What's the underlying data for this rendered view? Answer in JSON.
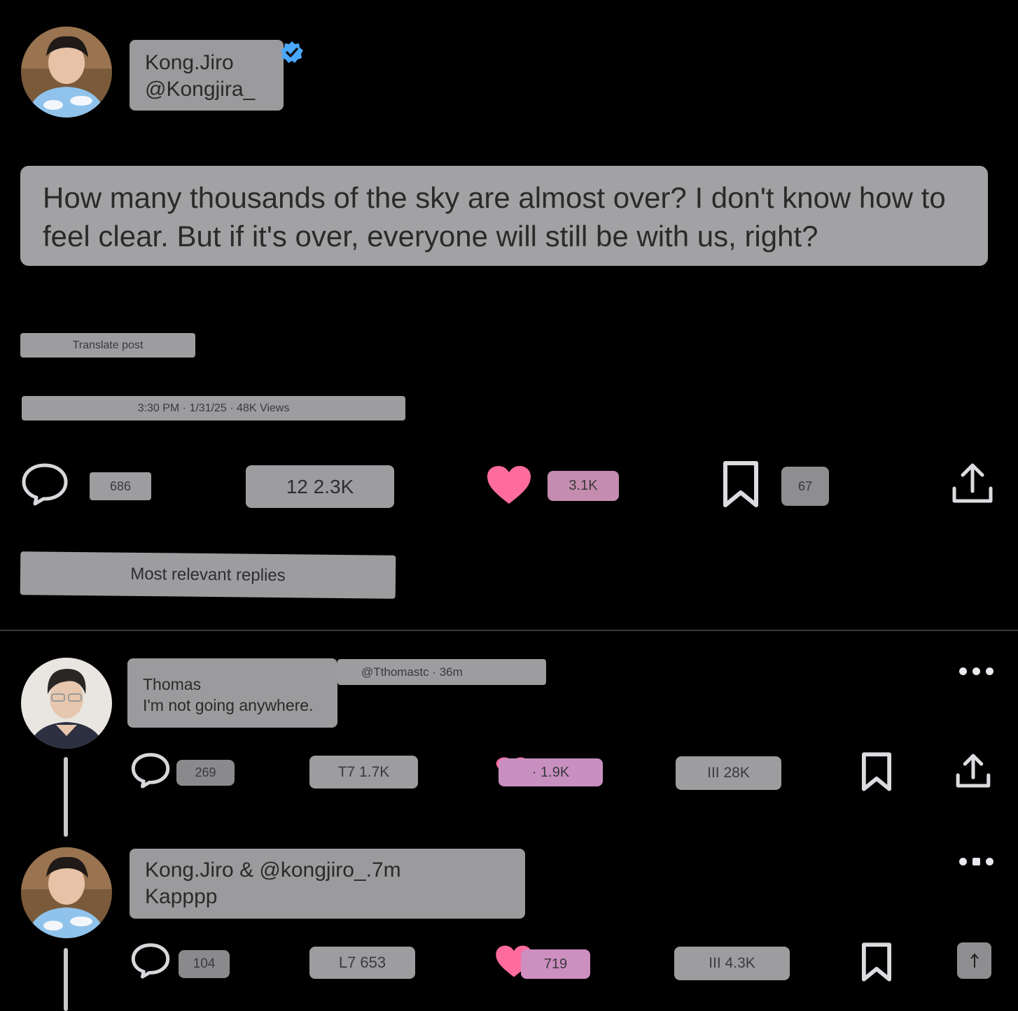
{
  "post": {
    "author_name": "Kong.Jiro",
    "author_handle": "@Kongjira_",
    "text": "How many thousands of the sky are almost over? I don't know how to feel clear. But if it's over, everyone will still be with us, right?",
    "translate_label": "Translate post",
    "meta": "3:30 PM · 1/31/25 · 48K Views",
    "stats": {
      "replies": "686",
      "reposts": "12 2.3K",
      "likes": "3.1K",
      "bookmarks": "67"
    }
  },
  "replies_header": "Most relevant replies",
  "replies": [
    {
      "name": "Thomas",
      "handle_time": "@Tthomastc · 36m",
      "text": "I'm not going anywhere.",
      "replies": "269",
      "reposts": "T7 1.7K",
      "likes": "· 1.9K",
      "views": "III 28K"
    },
    {
      "name_line": "Kong.Jiro & @kongjiro_.7m",
      "text": "Kapppp",
      "replies": "104",
      "reposts": "L7 653",
      "likes": "719",
      "views": "III 4.3K"
    }
  ],
  "colors": {
    "like": "#ff6b9d",
    "verified": "#4aa8ff",
    "background": "#000000"
  },
  "icons": [
    "comment-icon",
    "heart-icon",
    "bookmark-icon",
    "share-icon",
    "verified-badge-icon",
    "more-icon"
  ]
}
